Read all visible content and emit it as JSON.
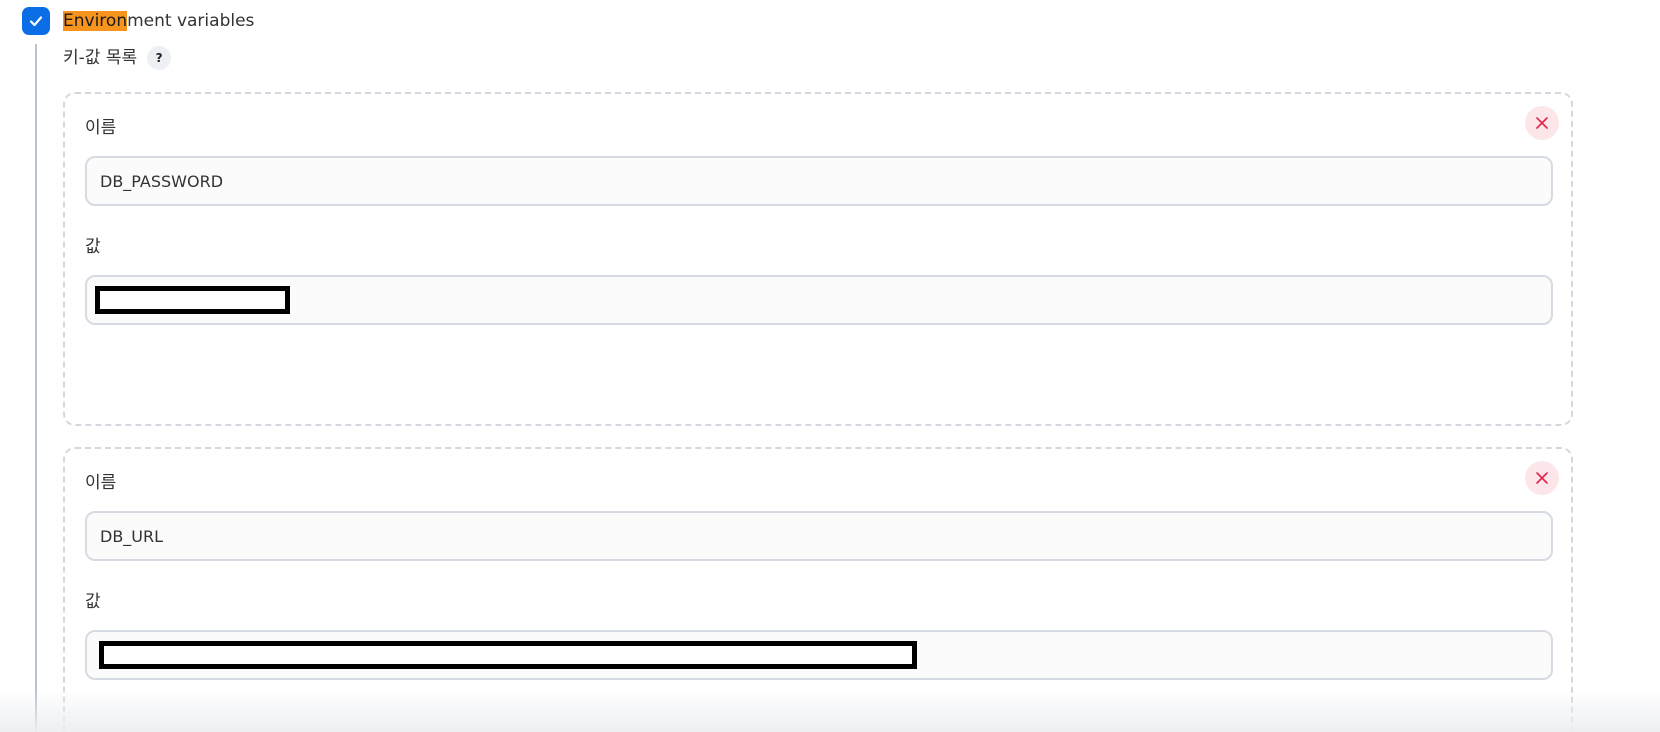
{
  "section": {
    "checked": true,
    "title_highlight": "Environ",
    "title_rest": "ment variables"
  },
  "key_value_list": {
    "label": "키-값 목록",
    "help_icon": "?"
  },
  "entries": [
    {
      "name_label": "이름",
      "name_value": "DB_PASSWORD",
      "value_label": "값",
      "value_value": "[redacted]"
    },
    {
      "name_label": "이름",
      "name_value": "DB_URL",
      "value_label": "값",
      "value_value": "[redacted]"
    }
  ],
  "colors": {
    "checkbox": "#0b6ee6",
    "highlight": "#f7941d",
    "remove_icon": "#e0244a"
  }
}
